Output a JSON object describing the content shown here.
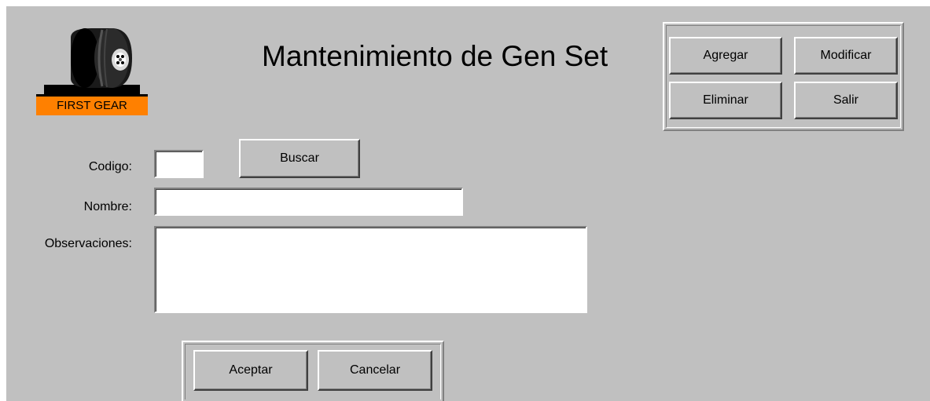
{
  "logo": {
    "text": "FIRST GEAR",
    "icon": "tire-icon",
    "accent_color": "#ff8000"
  },
  "title": "Mantenimiento de Gen Set",
  "toolbar": {
    "add_label": "Agregar",
    "modify_label": "Modificar",
    "delete_label": "Eliminar",
    "exit_label": "Salir"
  },
  "fields": {
    "codigo": {
      "label": "Codigo:",
      "value": ""
    },
    "nombre": {
      "label": "Nombre:",
      "value": ""
    },
    "observaciones": {
      "label": "Observaciones:",
      "value": ""
    }
  },
  "search_label": "Buscar",
  "footer": {
    "accept_label": "Aceptar",
    "cancel_label": "Cancelar"
  },
  "colors": {
    "form_background": "#c0c0c0",
    "field_background": "#ffffff"
  }
}
